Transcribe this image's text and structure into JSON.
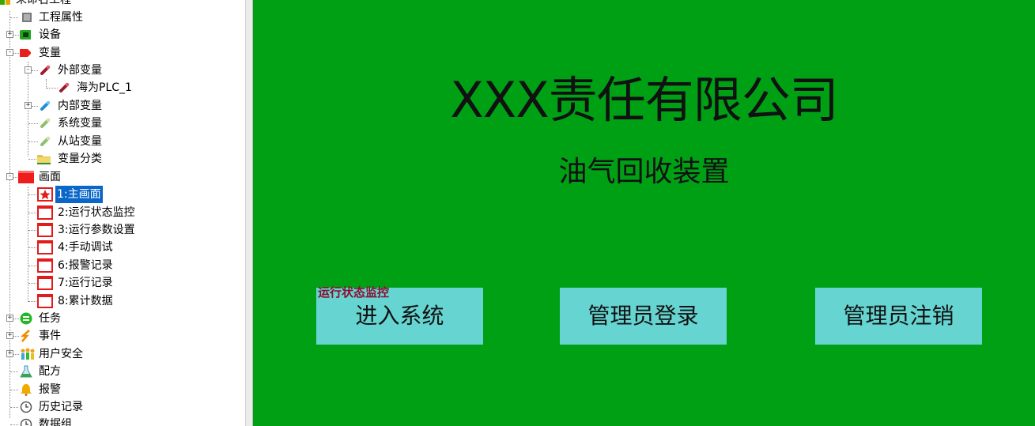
{
  "tree": {
    "items": [
      {
        "label": "未命名工程",
        "icon": "project-icon"
      },
      {
        "label": "工程属性",
        "icon": "properties-icon"
      },
      {
        "label": "设备",
        "icon": "device-icon",
        "expander": "+"
      },
      {
        "label": "变量",
        "icon": "variable-tag-icon",
        "expander": "-"
      },
      {
        "label": "外部变量",
        "icon": "pin-icon",
        "expander": "-"
      },
      {
        "label": "海为PLC_1",
        "icon": "pin-icon"
      },
      {
        "label": "内部变量",
        "icon": "pin-icon",
        "expander": "+"
      },
      {
        "label": "系统变量",
        "icon": "pin-icon"
      },
      {
        "label": "从站变量",
        "icon": "pin-icon"
      },
      {
        "label": "变量分类",
        "icon": "folder-icon"
      },
      {
        "label": "画面",
        "icon": "screen-icon",
        "expander": "-"
      },
      {
        "label": "1:主画面",
        "icon": "star-screen-icon",
        "selected": true
      },
      {
        "label": "2:运行状态监控",
        "icon": "screen-page-icon"
      },
      {
        "label": "3:运行参数设置",
        "icon": "screen-page-icon"
      },
      {
        "label": "4:手动调试",
        "icon": "screen-page-icon"
      },
      {
        "label": "6:报警记录",
        "icon": "screen-page-icon"
      },
      {
        "label": "7:运行记录",
        "icon": "screen-page-icon"
      },
      {
        "label": "8:累计数据",
        "icon": "screen-page-icon"
      },
      {
        "label": "任务",
        "icon": "task-icon",
        "expander": "+"
      },
      {
        "label": "事件",
        "icon": "event-icon",
        "expander": "+"
      },
      {
        "label": "用户安全",
        "icon": "users-icon",
        "expander": "+"
      },
      {
        "label": "配方",
        "icon": "recipe-icon"
      },
      {
        "label": "报警",
        "icon": "alarm-bell-icon"
      },
      {
        "label": "历史记录",
        "icon": "history-clock-icon"
      },
      {
        "label": "数据组",
        "icon": "data-group-icon"
      }
    ]
  },
  "screen": {
    "title": "XXX责任有限公司",
    "subtitle": "油气回收装置",
    "overlay_label": "运行状态监控",
    "buttons": [
      {
        "label": "进入系统"
      },
      {
        "label": "管理员登录"
      },
      {
        "label": "管理员注销"
      }
    ],
    "background_color": "#00a015",
    "button_color": "#66d5d2"
  }
}
